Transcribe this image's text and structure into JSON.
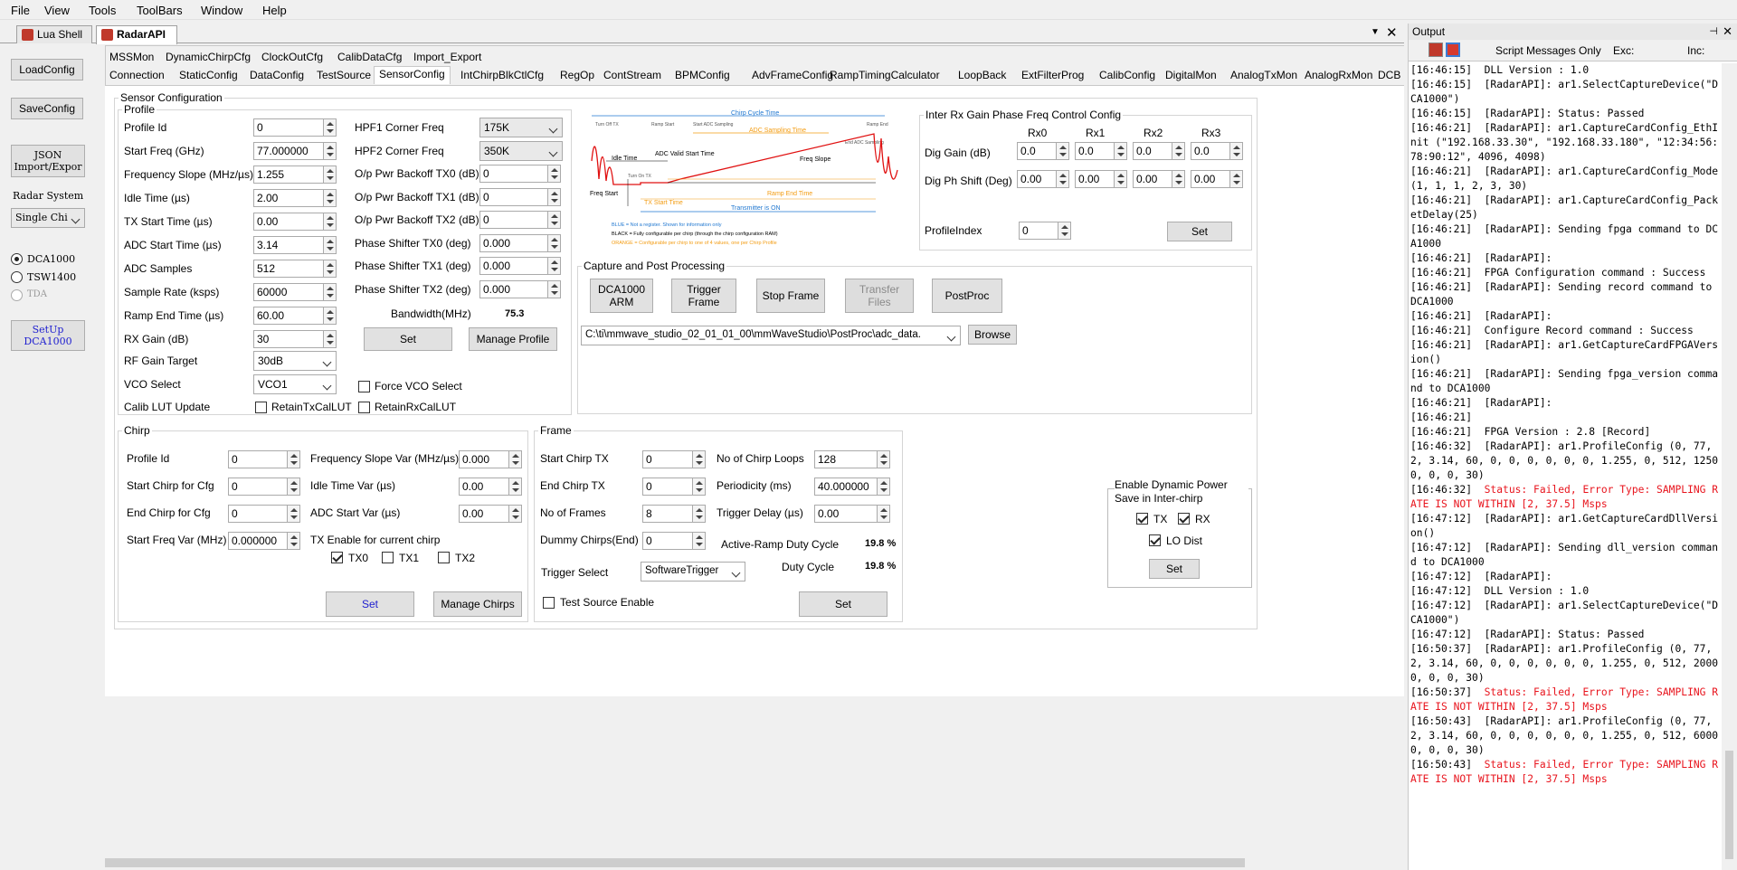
{
  "menu": [
    "File",
    "View",
    "Tools",
    "ToolBars",
    "Window",
    "Help"
  ],
  "doc_tabs": [
    {
      "label": "Lua Shell"
    },
    {
      "label": "RadarAPI"
    }
  ],
  "left": {
    "load_config": "LoadConfig",
    "save_config": "SaveConfig",
    "json": "JSON Import/Expor",
    "radar_system_label": "Radar System",
    "radar_system_value": "Single Chi",
    "radios": [
      "DCA1000",
      "TSW1400",
      "TDA"
    ],
    "setup": "SetUp DCA1000"
  },
  "subtabs_row1": [
    "MSSMon",
    "DynamicChirpCfg",
    "ClockOutCfg",
    "CalibDataCfg",
    "Import_Export"
  ],
  "subtabs_row2": [
    "Connection",
    "StaticConfig",
    "DataConfig",
    "TestSource",
    "SensorConfig",
    "IntChirpBlkCtlCfg",
    "RegOp",
    "ContStream",
    "BPMConfig",
    "AdvFrameConfig",
    "RampTimingCalculator",
    "LoopBack",
    "ExtFilterProg",
    "CalibConfig",
    "DigitalMon",
    "AnalogTxMon",
    "AnalogRxMon",
    "DCB"
  ],
  "sensor": {
    "title": "Sensor Configuration",
    "profile_title": "Profile",
    "profile_fields": [
      {
        "label": "Profile Id",
        "value": "0"
      },
      {
        "label": "Start Freq (GHz)",
        "value": "77.000000"
      },
      {
        "label": "Frequency Slope (MHz/µs)",
        "value": "1.255"
      },
      {
        "label": "Idle Time (µs)",
        "value": "2.00"
      },
      {
        "label": "TX Start Time (µs)",
        "value": "0.00"
      },
      {
        "label": "ADC Start Time (µs)",
        "value": "3.14"
      },
      {
        "label": "ADC Samples",
        "value": "512"
      },
      {
        "label": "Sample Rate (ksps)",
        "value": "60000"
      },
      {
        "label": "Ramp End Time (µs)",
        "value": "60.00"
      },
      {
        "label": "RX Gain (dB)",
        "value": "30"
      }
    ],
    "rf_gain_label": "RF Gain Target",
    "rf_gain_value": "30dB",
    "vco_label": "VCO Select",
    "vco_value": "VCO1",
    "calib_lut_label": "Calib LUT Update",
    "retain_tx": "RetainTxCalLUT",
    "retain_rx": "RetainRxCalLUT",
    "force_vco": "Force VCO Select",
    "right_fields": [
      {
        "label": "HPF1 Corner Freq",
        "value": "175K",
        "type": "select"
      },
      {
        "label": "HPF2 Corner Freq",
        "value": "350K",
        "type": "select"
      },
      {
        "label": "O/p Pwr Backoff TX0 (dB)",
        "value": "0"
      },
      {
        "label": "O/p Pwr Backoff TX1 (dB)",
        "value": "0"
      },
      {
        "label": "O/p Pwr Backoff TX2 (dB)",
        "value": "0"
      },
      {
        "label": "Phase Shifter TX0 (deg)",
        "value": "0.000"
      },
      {
        "label": "Phase Shifter TX1 (deg)",
        "value": "0.000"
      },
      {
        "label": "Phase Shifter TX2 (deg)",
        "value": "0.000"
      }
    ],
    "bandwidth_label": "Bandwidth(MHz)",
    "bandwidth_value": "75.3",
    "set": "Set",
    "manage_profile": "Manage Profile"
  },
  "diagram": {
    "chirp_cycle": "Chirp Cycle Time",
    "turn_off_tx": "Turn Off TX",
    "ramp_start": "Ramp Start",
    "start_adc": "Start ADC Sampling",
    "adc_sampling": "ADC Sampling Time",
    "end_adc": "End ADC Sampling",
    "ramp_end": "Ramp End",
    "idle": "Idle Time",
    "adc_valid": "ADC Valid Start Time",
    "freq_slope": "Freq Slope",
    "turn_on_tx": "Turn On TX",
    "freq_start": "Freq Start",
    "tx_start": "TX Start Time",
    "ramp_end_time": "Ramp End Time",
    "tx_on": "Transmitter is ON",
    "legend_blue": "BLUE = Not a register. Shown for information only",
    "legend_black": "BLACK = Fully configurable per chirp (through the chirp configuration RAM)",
    "legend_orange": "ORANGE = Configurable per chirp to one of 4 values, one per Chirp Profile"
  },
  "interrx": {
    "title": "Inter Rx Gain Phase Freq Control Config",
    "cols": [
      "Rx0",
      "Rx1",
      "Rx2",
      "Rx3"
    ],
    "dig_gain_label": "Dig Gain (dB)",
    "dig_gain": [
      "0.0",
      "0.0",
      "0.0",
      "0.0"
    ],
    "dig_ph_label": "Dig Ph Shift (Deg)",
    "dig_ph": [
      "0.00",
      "0.00",
      "0.00",
      "0.00"
    ],
    "profile_index_label": "ProfileIndex",
    "profile_index": "0",
    "set": "Set"
  },
  "capture": {
    "title": "Capture and Post Processing",
    "buttons": [
      "DCA1000 ARM",
      "Trigger Frame",
      "Stop Frame",
      "Transfer Files",
      "PostProc"
    ],
    "path": "C:\\ti\\mmwave_studio_02_01_01_00\\mmWaveStudio\\PostProc\\adc_data.",
    "browse": "Browse"
  },
  "chirp": {
    "title": "Chirp",
    "left": [
      {
        "label": "Profile Id",
        "value": "0"
      },
      {
        "label": "Start Chirp for Cfg",
        "value": "0"
      },
      {
        "label": "End Chirp for Cfg",
        "value": "0"
      },
      {
        "label": "Start Freq Var (MHz)",
        "value": "0.000000"
      }
    ],
    "right": [
      {
        "label": "Frequency Slope Var (MHz/µs)",
        "value": "0.000"
      },
      {
        "label": "Idle Time Var (µs)",
        "value": "0.00"
      },
      {
        "label": "ADC Start Var (µs)",
        "value": "0.00"
      }
    ],
    "tx_enable_label": "TX Enable for current chirp",
    "tx": [
      "TX0",
      "TX1",
      "TX2"
    ],
    "set": "Set",
    "manage": "Manage Chirps"
  },
  "frame": {
    "title": "Frame",
    "left": [
      {
        "label": "Start Chirp TX",
        "value": "0"
      },
      {
        "label": "End Chirp TX",
        "value": "0"
      },
      {
        "label": "No of Frames",
        "value": "8"
      },
      {
        "label": "Dummy Chirps(End)",
        "value": "0"
      }
    ],
    "right": [
      {
        "label": "No of Chirp Loops",
        "value": "128"
      },
      {
        "label": "Periodicity (ms)",
        "value": "40.000000"
      },
      {
        "label": "Trigger Delay (µs)",
        "value": "0.00"
      }
    ],
    "active_ramp_label": "Active-Ramp Duty Cycle",
    "active_ramp_value": "19.8 %",
    "duty_label": "Duty Cycle",
    "duty_value": "19.8 %",
    "trigger_label": "Trigger Select",
    "trigger_value": "SoftwareTrigger",
    "test_source": "Test Source Enable",
    "set": "Set"
  },
  "power": {
    "title": "Enable Dynamic Power Save in Inter-chirp",
    "tx": "TX",
    "rx": "RX",
    "lo": "LO Dist",
    "set": "Set"
  },
  "output": {
    "title": "Output",
    "filter": "Script Messages Only",
    "exc": "Exc:",
    "inc": "Inc:",
    "lines": [
      {
        "t": "[16:46:15]  DLL Version : 1.0",
        "err": false
      },
      {
        "t": "[16:46:15]  [RadarAPI]: ar1.SelectCaptureDevice(\"DCA1000\")",
        "err": false
      },
      {
        "t": "[16:46:15]  [RadarAPI]: Status: Passed",
        "err": false
      },
      {
        "t": "[16:46:21]  [RadarAPI]: ar1.CaptureCardConfig_EthInit (\"192.168.33.30\", \"192.168.33.180\", \"12:34:56:78:90:12\", 4096, 4098)",
        "err": false
      },
      {
        "t": "[16:46:21]  [RadarAPI]: ar1.CaptureCardConfig_Mode(1, 1, 1, 2, 3, 30)",
        "err": false
      },
      {
        "t": "[16:46:21]  [RadarAPI]: ar1.CaptureCardConfig_PacketDelay(25)",
        "err": false
      },
      {
        "t": "[16:46:21]  [RadarAPI]: Sending fpga command to DCA1000",
        "err": false
      },
      {
        "t": "[16:46:21]  [RadarAPI]:",
        "err": false
      },
      {
        "t": "[16:46:21]  FPGA Configuration command : Success",
        "err": false
      },
      {
        "t": "[16:46:21]  [RadarAPI]: Sending record command to DCA1000",
        "err": false
      },
      {
        "t": "[16:46:21]  [RadarAPI]:",
        "err": false
      },
      {
        "t": "[16:46:21]  Configure Record command : Success",
        "err": false
      },
      {
        "t": "[16:46:21]  [RadarAPI]: ar1.GetCaptureCardFPGAVersion()",
        "err": false
      },
      {
        "t": "[16:46:21]  [RadarAPI]: Sending fpga_version command to DCA1000",
        "err": false
      },
      {
        "t": "[16:46:21]  [RadarAPI]:",
        "err": false
      },
      {
        "t": "[16:46:21]",
        "err": false
      },
      {
        "t": "[16:46:21]  FPGA Version : 2.8 [Record]",
        "err": false
      },
      {
        "t": "[16:46:32]  [RadarAPI]: ar1.ProfileConfig (0, 77, 2, 3.14, 60, 0, 0, 0, 0, 0, 0, 1.255, 0, 512, 12500, 0, 0, 30)",
        "err": false
      },
      {
        "t": "[16:46:32]  Status: Failed, Error Type: SAMPLING RATE IS NOT WITHIN [2, 37.5] Msps",
        "err": true
      },
      {
        "t": "[16:47:12]  [RadarAPI]: ar1.GetCaptureCardDllVersion()",
        "err": false
      },
      {
        "t": "[16:47:12]  [RadarAPI]: Sending dll_version command to DCA1000",
        "err": false
      },
      {
        "t": "[16:47:12]  [RadarAPI]:",
        "err": false
      },
      {
        "t": "[16:47:12]  DLL Version : 1.0",
        "err": false
      },
      {
        "t": "[16:47:12]  [RadarAPI]: ar1.SelectCaptureDevice(\"DCA1000\")",
        "err": false
      },
      {
        "t": "[16:47:12]  [RadarAPI]: Status: Passed",
        "err": false
      },
      {
        "t": "[16:50:37]  [RadarAPI]: ar1.ProfileConfig (0, 77, 2, 3.14, 60, 0, 0, 0, 0, 0, 0, 1.255, 0, 512, 20000, 0, 0, 30)",
        "err": false
      },
      {
        "t": "[16:50:37]  Status: Failed, Error Type: SAMPLING RATE IS NOT WITHIN [2, 37.5] Msps",
        "err": true
      },
      {
        "t": "[16:50:43]  [RadarAPI]: ar1.ProfileConfig (0, 77, 2, 3.14, 60, 0, 0, 0, 0, 0, 0, 1.255, 0, 512, 60000, 0, 0, 30)",
        "err": false
      },
      {
        "t": "[16:50:43]  Status: Failed, Error Type: SAMPLING RATE IS NOT WITHIN [2, 37.5] Msps",
        "err": true
      }
    ]
  },
  "colors": {
    "error": "#e8141d",
    "accent_blue": "#2020d0",
    "diagram_blue": "#1f77d0",
    "diagram_orange": "#f39c12",
    "diagram_red": "#e01010"
  }
}
